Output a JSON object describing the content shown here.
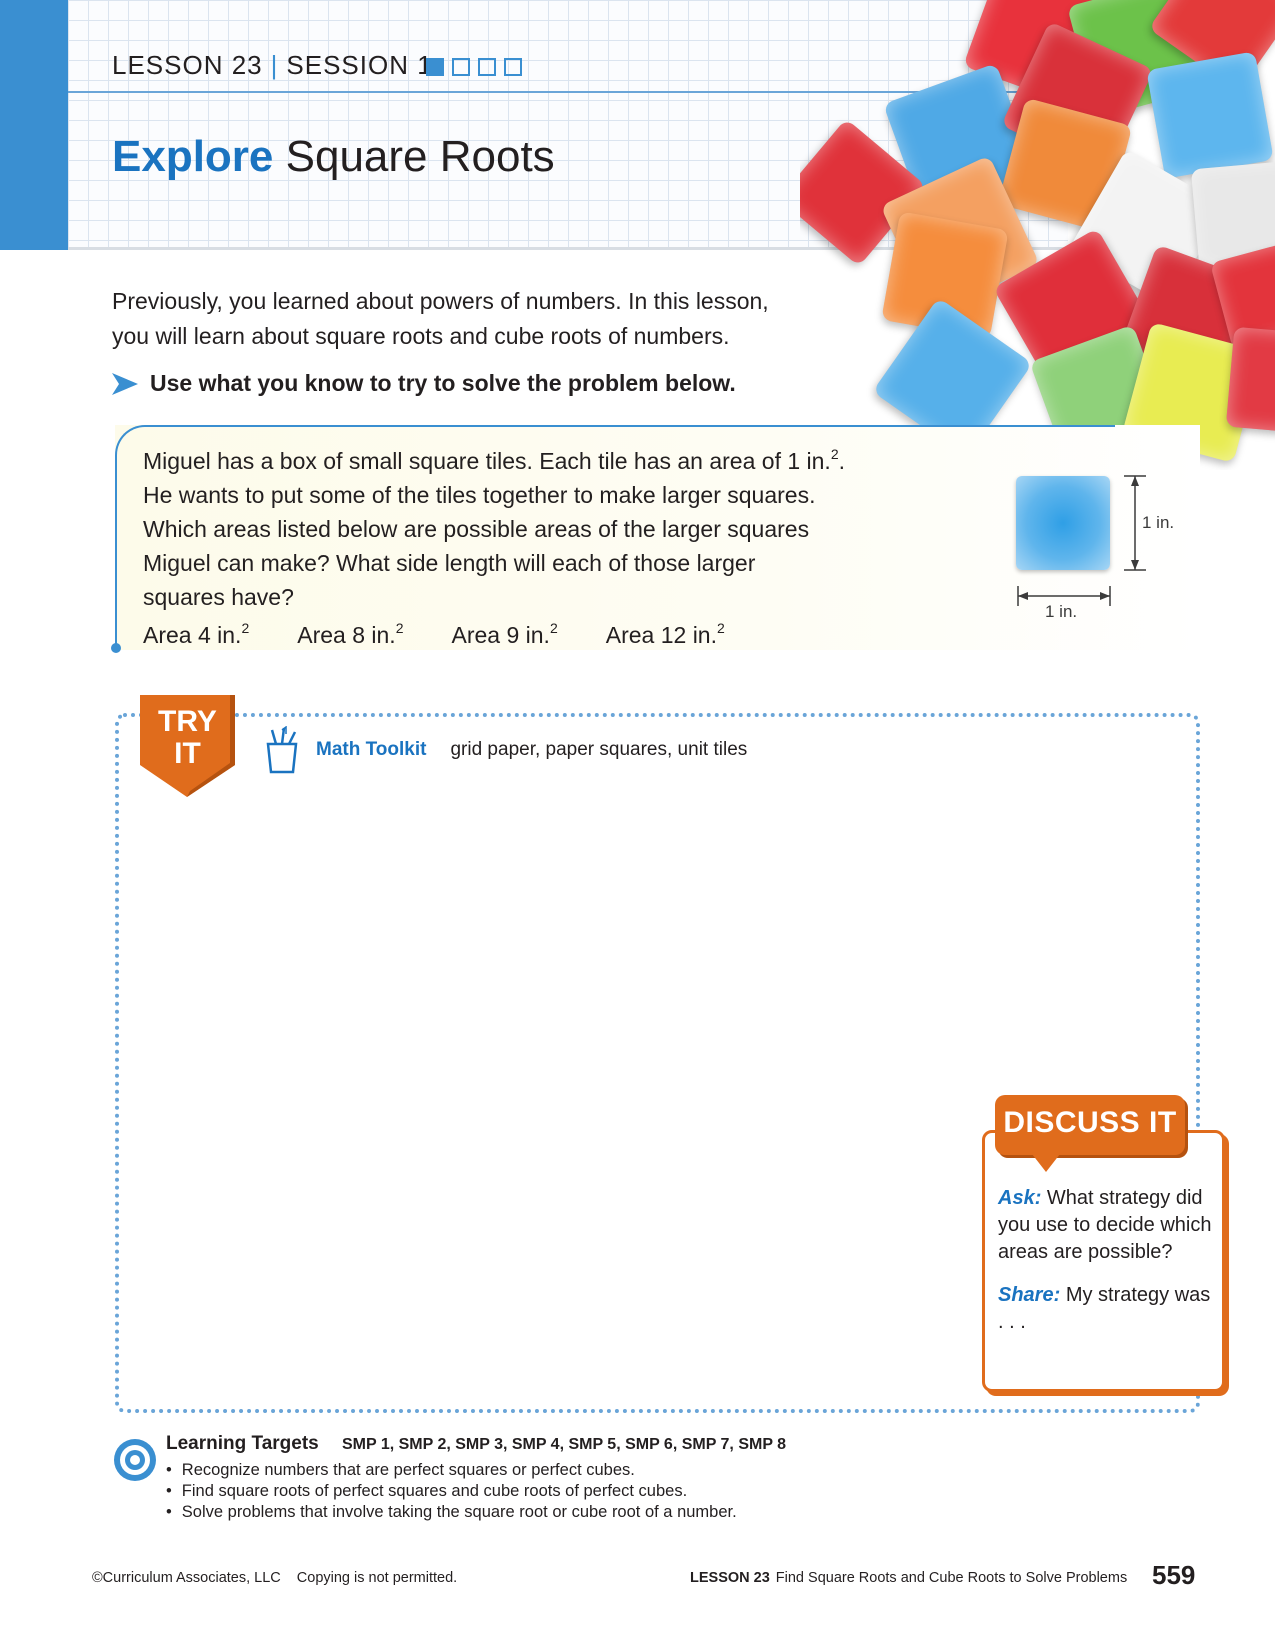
{
  "header": {
    "lesson": "LESSON 23",
    "session": "SESSION 1",
    "session_progress": {
      "current": 1,
      "total": 4
    },
    "title_highlight": "Explore",
    "title_rest": "Square Roots"
  },
  "intro": {
    "line1": "Previously, you learned about powers of numbers. In this lesson,",
    "line2": "you will learn about square roots and cube roots of numbers.",
    "instruction": "Use what you know to try to solve the problem below."
  },
  "problem": {
    "line1_text": "Miguel has a box of small square tiles. Each tile has an area of 1 in.",
    "line1_exp": "2",
    "line1_end": ".",
    "line2": "He wants to put some of the tiles together to make larger squares.",
    "line3": "Which areas listed below are possible areas of the larger squares",
    "line4": "Miguel can make? What side length will each of those larger",
    "line5": "squares have?",
    "areas": [
      {
        "label": "Area 4 in.",
        "exp": "2"
      },
      {
        "label": "Area 8 in.",
        "exp": "2"
      },
      {
        "label": "Area 9 in.",
        "exp": "2"
      },
      {
        "label": "Area 12 in.",
        "exp": "2"
      }
    ],
    "tile_side_label": "1 in.",
    "tile_bottom_label": "1 in."
  },
  "try_it": {
    "line1": "TRY",
    "line2": "IT",
    "toolkit_label": "Math Toolkit",
    "toolkit_items": "grid paper, paper squares, unit tiles"
  },
  "discuss": {
    "title": "DISCUSS IT",
    "ask_label": "Ask:",
    "ask_text": "What strategy did you use to decide which areas are possible?",
    "share_label": "Share:",
    "share_text": "My strategy was . . ."
  },
  "learning_targets": {
    "title": "Learning Targets",
    "smp": "SMP 1, SMP 2, SMP 3, SMP 4, SMP 5, SMP 6, SMP 7, SMP 8",
    "items": [
      "Recognize numbers that are perfect squares or perfect cubes.",
      "Find square roots of perfect squares and cube roots of perfect cubes.",
      "Solve problems that involve taking the square root or cube root of a number."
    ]
  },
  "footer": {
    "copyright": "©Curriculum Associates, LLC",
    "copy_notice": "Copying is not permitted.",
    "lesson": "LESSON 23",
    "lesson_title": "Find Square Roots and Cube Roots to Solve Problems",
    "page_number": "559"
  },
  "colors": {
    "brand_blue": "#1a73c0",
    "bar_blue": "#3a8fd1",
    "orange": "#e06c1c"
  }
}
